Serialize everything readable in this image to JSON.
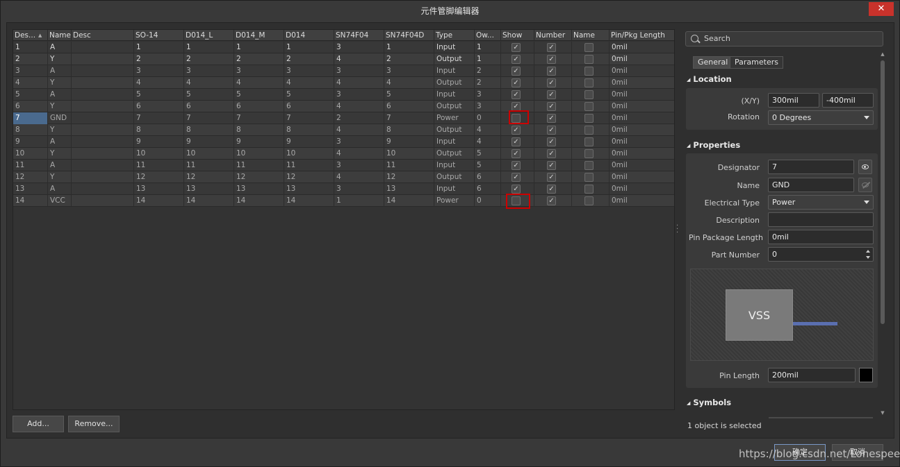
{
  "window": {
    "title": "元件管脚编辑器",
    "close_glyph": "✕"
  },
  "table": {
    "columns": [
      {
        "label": "Des...",
        "w": 50
      },
      {
        "label": "Name",
        "w": 34
      },
      {
        "label": "Desc",
        "w": 90
      },
      {
        "label": "SO-14",
        "w": 72
      },
      {
        "label": "D014_L",
        "w": 72
      },
      {
        "label": "D014_M",
        "w": 72
      },
      {
        "label": "D014",
        "w": 72
      },
      {
        "label": "SN74F04",
        "w": 72
      },
      {
        "label": "SN74F04D",
        "w": 72
      },
      {
        "label": "Type",
        "w": 58
      },
      {
        "label": "Ow...",
        "w": 38
      },
      {
        "label": "Show",
        "w": 48
      },
      {
        "label": "Number",
        "w": 54
      },
      {
        "label": "Name",
        "w": 54
      },
      {
        "label": "Pin/Pkg Length",
        "w": 95
      }
    ],
    "sort_glyph": "▲",
    "rows": [
      {
        "des": "1",
        "name": "A",
        "desc": "",
        "so14": "1",
        "d014l": "1",
        "d014m": "1",
        "d014": "1",
        "sn74f04": "3",
        "sn74f04d": "1",
        "type": "Input",
        "owner": "1",
        "show": true,
        "number": true,
        "pname": false,
        "len": "0mil"
      },
      {
        "des": "2",
        "name": "Y",
        "desc": "",
        "so14": "2",
        "d014l": "2",
        "d014m": "2",
        "d014": "2",
        "sn74f04": "4",
        "sn74f04d": "2",
        "type": "Output",
        "owner": "1",
        "show": true,
        "number": true,
        "pname": false,
        "len": "0mil"
      },
      {
        "des": "3",
        "name": "A",
        "desc": "",
        "so14": "3",
        "d014l": "3",
        "d014m": "3",
        "d014": "3",
        "sn74f04": "3",
        "sn74f04d": "3",
        "type": "Input",
        "owner": "2",
        "show": true,
        "number": true,
        "pname": false,
        "len": "0mil"
      },
      {
        "des": "4",
        "name": "Y",
        "desc": "",
        "so14": "4",
        "d014l": "4",
        "d014m": "4",
        "d014": "4",
        "sn74f04": "4",
        "sn74f04d": "4",
        "type": "Output",
        "owner": "2",
        "show": true,
        "number": true,
        "pname": false,
        "len": "0mil"
      },
      {
        "des": "5",
        "name": "A",
        "desc": "",
        "so14": "5",
        "d014l": "5",
        "d014m": "5",
        "d014": "5",
        "sn74f04": "3",
        "sn74f04d": "5",
        "type": "Input",
        "owner": "3",
        "show": true,
        "number": true,
        "pname": false,
        "len": "0mil"
      },
      {
        "des": "6",
        "name": "Y",
        "desc": "",
        "so14": "6",
        "d014l": "6",
        "d014m": "6",
        "d014": "6",
        "sn74f04": "4",
        "sn74f04d": "6",
        "type": "Output",
        "owner": "3",
        "show": true,
        "number": true,
        "pname": false,
        "len": "0mil"
      },
      {
        "des": "7",
        "name": "GND",
        "desc": "",
        "so14": "7",
        "d014l": "7",
        "d014m": "7",
        "d014": "7",
        "sn74f04": "2",
        "sn74f04d": "7",
        "type": "Power",
        "owner": "0",
        "show": false,
        "number": true,
        "pname": false,
        "len": "0mil",
        "selected": true
      },
      {
        "des": "8",
        "name": "Y",
        "desc": "",
        "so14": "8",
        "d014l": "8",
        "d014m": "8",
        "d014": "8",
        "sn74f04": "4",
        "sn74f04d": "8",
        "type": "Output",
        "owner": "4",
        "show": true,
        "number": true,
        "pname": false,
        "len": "0mil"
      },
      {
        "des": "9",
        "name": "A",
        "desc": "",
        "so14": "9",
        "d014l": "9",
        "d014m": "9",
        "d014": "9",
        "sn74f04": "3",
        "sn74f04d": "9",
        "type": "Input",
        "owner": "4",
        "show": true,
        "number": true,
        "pname": false,
        "len": "0mil"
      },
      {
        "des": "10",
        "name": "Y",
        "desc": "",
        "so14": "10",
        "d014l": "10",
        "d014m": "10",
        "d014": "10",
        "sn74f04": "4",
        "sn74f04d": "10",
        "type": "Output",
        "owner": "5",
        "show": true,
        "number": true,
        "pname": false,
        "len": "0mil"
      },
      {
        "des": "11",
        "name": "A",
        "desc": "",
        "so14": "11",
        "d014l": "11",
        "d014m": "11",
        "d014": "11",
        "sn74f04": "3",
        "sn74f04d": "11",
        "type": "Input",
        "owner": "5",
        "show": true,
        "number": true,
        "pname": false,
        "len": "0mil"
      },
      {
        "des": "12",
        "name": "Y",
        "desc": "",
        "so14": "12",
        "d014l": "12",
        "d014m": "12",
        "d014": "12",
        "sn74f04": "4",
        "sn74f04d": "12",
        "type": "Output",
        "owner": "6",
        "show": true,
        "number": true,
        "pname": false,
        "len": "0mil"
      },
      {
        "des": "13",
        "name": "A",
        "desc": "",
        "so14": "13",
        "d014l": "13",
        "d014m": "13",
        "d014": "13",
        "sn74f04": "3",
        "sn74f04d": "13",
        "type": "Input",
        "owner": "6",
        "show": true,
        "number": true,
        "pname": false,
        "len": "0mil"
      },
      {
        "des": "14",
        "name": "VCC",
        "desc": "",
        "so14": "14",
        "d014l": "14",
        "d014m": "14",
        "d014": "14",
        "sn74f04": "1",
        "sn74f04d": "14",
        "type": "Power",
        "owner": "0",
        "show": false,
        "number": true,
        "pname": false,
        "len": "0mil"
      }
    ],
    "check_glyph": "✓"
  },
  "buttons": {
    "add": "Add...",
    "remove": "Remove..."
  },
  "props": {
    "search_placeholder": "Search",
    "tabs": [
      "General",
      "Parameters"
    ],
    "location": {
      "title": "Location",
      "xy_label": "(X/Y)",
      "x": "300mil",
      "y": "-400mil",
      "rotation_label": "Rotation",
      "rotation": "0 Degrees"
    },
    "properties": {
      "title": "Properties",
      "designator_label": "Designator",
      "designator": "7",
      "name_label": "Name",
      "name": "GND",
      "etype_label": "Electrical Type",
      "etype": "Power",
      "desc_label": "Description",
      "desc": "",
      "ppl_label": "Pin Package Length",
      "ppl": "0mil",
      "partnum_label": "Part Number",
      "partnum": "0",
      "preview_symbol": "VSS",
      "pinlen_label": "Pin Length",
      "pinlen": "200mil"
    },
    "symbols": {
      "title": "Symbols"
    },
    "status": "1 object is selected"
  },
  "footer": {
    "ok": "确定",
    "cancel": "取消"
  },
  "watermark": "https://blog.csdn.net/Lonespeed",
  "colors": {
    "selected_cell": "#4a6a8e",
    "highlight": "#cc0000",
    "pin_line": "#5a6fb0"
  }
}
